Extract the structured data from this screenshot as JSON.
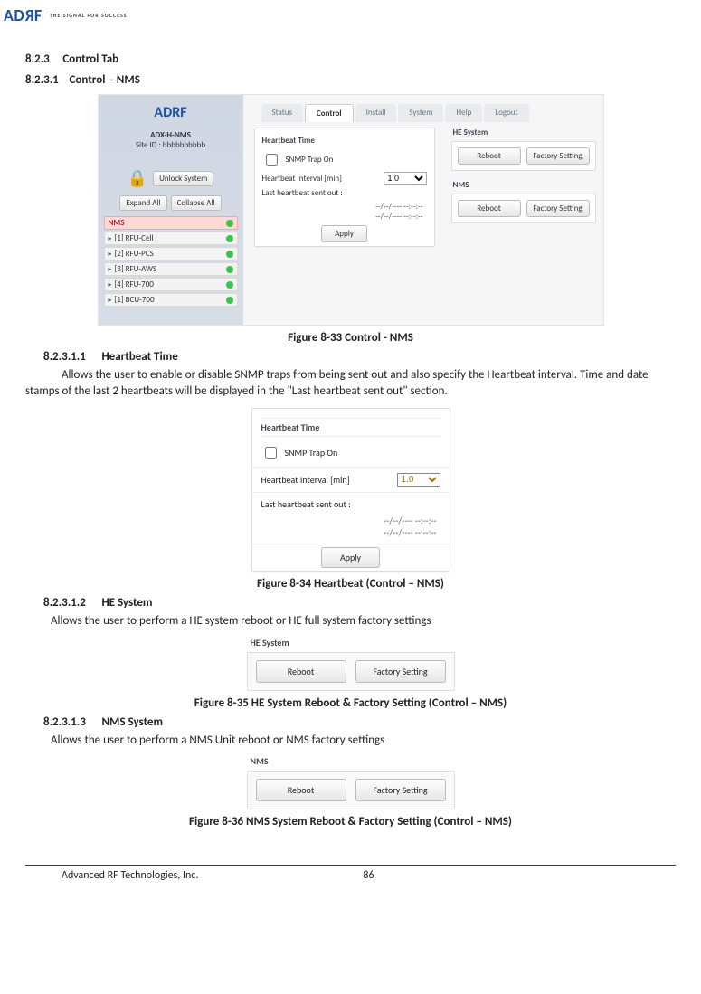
{
  "logo": {
    "brand": "ADRF",
    "tagline": "THE SIGNAL FOR SUCCESS"
  },
  "sections": {
    "s823_num": "8.2.3",
    "s823_title": "Control Tab",
    "s8231_num": "8.2.3.1",
    "s8231_title": "Control – NMS",
    "s82311_num": "8.2.3.1.1",
    "s82311_title": "Heartbeat Time",
    "s82311_text": "Allows the user to enable or disable SNMP traps from being sent out and also specify the Heartbeat interval. Time and date stamps of the last 2 heartbeats will be displayed in the \"Last heartbeat sent out\" section.",
    "s82312_num": "8.2.3.1.2",
    "s82312_title": "HE System",
    "s82312_text": "Allows the user to perform a HE system reboot or HE full system factory settings",
    "s82313_num": "8.2.3.1.3",
    "s82313_title": "NMS System",
    "s82313_text": "Allows the user to perform a NMS Unit reboot or NMS factory settings"
  },
  "captions": {
    "fig33": "Figure 8-33    Control - NMS",
    "fig34": "Figure 8-34    Heartbeat (Control – NMS)",
    "fig35": "Figure 8-35    HE System Reboot & Factory Setting (Control – NMS)",
    "fig36": "Figure 8-36    NMS System Reboot & Factory Setting (Control – NMS)"
  },
  "ui": {
    "sidebar": {
      "logo": "ADRF",
      "model": "ADX-H-NMS",
      "siteid": "Site ID : bbbbbbbbbb",
      "unlock": "Unlock System",
      "expand": "Expand All",
      "collapse": "Collapse All",
      "tree_root": "NMS",
      "tree_items": [
        "[1] RFU-Cell",
        "[2] RFU-PCS",
        "[3] RFU-AWS",
        "[4] RFU-700",
        "[1] BCU-700"
      ]
    },
    "tabs": {
      "status": "Status",
      "control": "Control",
      "install": "Install",
      "system": "System",
      "help": "Help",
      "logout": "Logout"
    },
    "heartbeat": {
      "title": "Heartbeat Time",
      "snmp_label": "SNMP Trap On",
      "interval_label": "Heartbeat Interval [min]",
      "interval_value": "1.0",
      "last_sent_label": "Last heartbeat sent out :",
      "ts1": "--/--/----  --:--:--",
      "ts2": "--/--/----  --:--:--",
      "apply": "Apply"
    },
    "he": {
      "title": "HE System",
      "reboot": "Reboot",
      "factory": "Factory Setting"
    },
    "nms": {
      "title": "NMS",
      "reboot": "Reboot",
      "factory": "Factory Setting"
    }
  },
  "footer": {
    "company": "Advanced RF Technologies, Inc.",
    "page": "86"
  }
}
